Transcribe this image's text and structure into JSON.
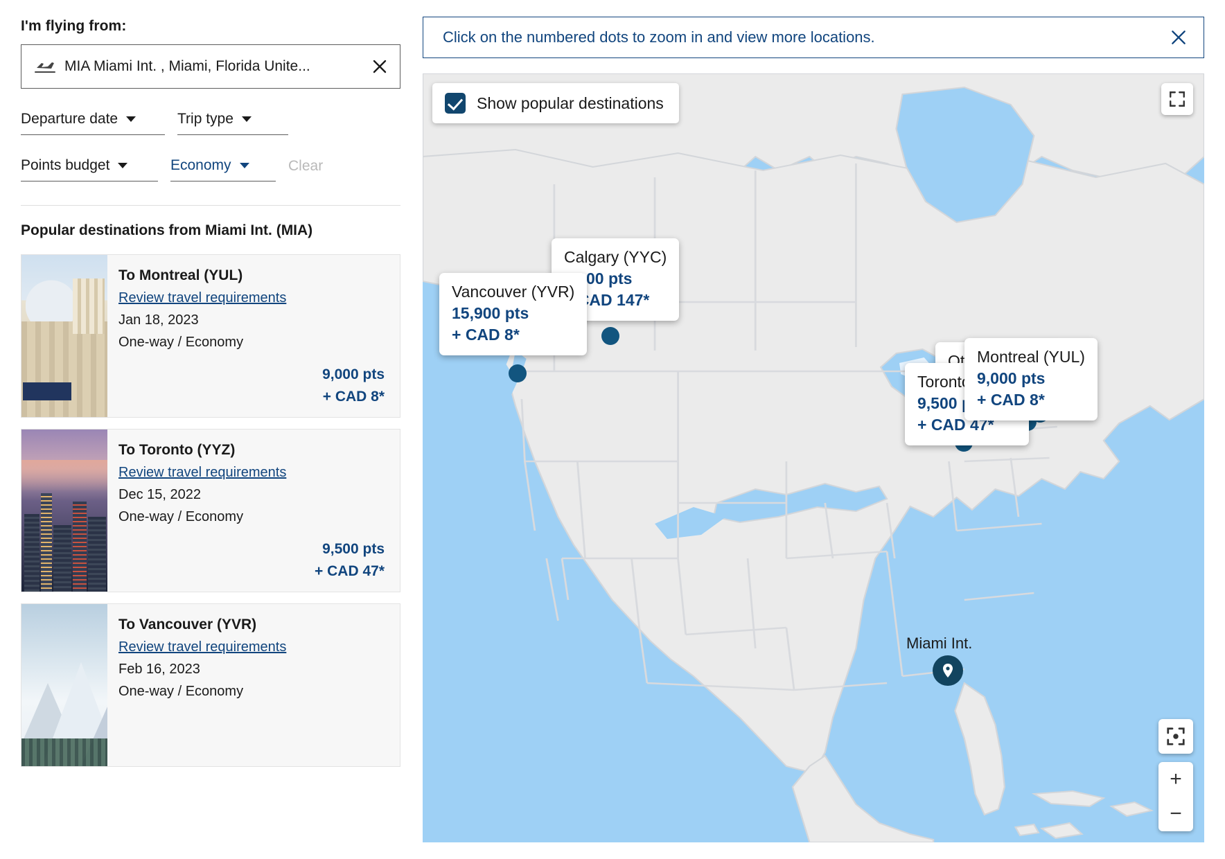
{
  "search": {
    "flying_from_label": "I'm flying from:",
    "origin_value": "MIA Miami Int. , Miami, Florida Unite...",
    "origin_clear_icon": "close-icon",
    "plane_icon": "airplane-departure-icon",
    "filters": [
      {
        "label": "Departure date",
        "accent": false
      },
      {
        "label": "Trip type",
        "accent": false
      },
      {
        "label": "Points budget",
        "accent": false
      },
      {
        "label": "Economy",
        "accent": true
      }
    ],
    "clear_label": "Clear"
  },
  "popular": {
    "title": "Popular destinations from Miami Int.  (MIA)",
    "cards": [
      {
        "title": "To Montreal (YUL)",
        "link": "Review travel requirements",
        "date": "Jan 18, 2023",
        "cabin": "One-way / Economy",
        "points": "9,000 pts",
        "cash": "+ CAD 8*"
      },
      {
        "title": "To Toronto (YYZ)",
        "link": "Review travel requirements",
        "date": "Dec 15, 2022",
        "cabin": "One-way / Economy",
        "points": "9,500 pts",
        "cash": "+ CAD 47*"
      },
      {
        "title": "To Vancouver (YVR)",
        "link": "Review travel requirements",
        "date": "Feb 16, 2023",
        "cabin": "One-way / Economy",
        "points": "",
        "cash": ""
      }
    ]
  },
  "map": {
    "notice": "Click on the numbered dots to zoom in and view more locations.",
    "notice_close_icon": "close-icon",
    "show_destinations_label": "Show popular destinations",
    "show_destinations_checked": true,
    "fullscreen_icon": "fullscreen-icon",
    "locate_icon": "recenter-icon",
    "zoom_in_label": "+",
    "zoom_out_label": "−",
    "origin_marker_label": "Miami Int.",
    "origin_marker_icon": "map-pin-icon",
    "tooltips": [
      {
        "city": "Vancouver (YVR)",
        "points": "15,900 pts",
        "cash": "+ CAD 8*"
      },
      {
        "city": "Calgary (YYC)",
        "points": "9,300 pts",
        "cash": "+ CAD 147*"
      },
      {
        "city": "Ottawa (YOW)",
        "points": "",
        "cash": ""
      },
      {
        "city": "Toronto (YYZ)",
        "points": "9,500 pts",
        "cash": "+ CAD 47*"
      },
      {
        "city": "Montreal (YUL)",
        "points": "9,000 pts",
        "cash": "+ CAD 8*"
      }
    ]
  },
  "colors": {
    "accent": "#11457e",
    "water": "#9ed0f5",
    "land": "#ebebeb",
    "marker": "#12557f"
  }
}
